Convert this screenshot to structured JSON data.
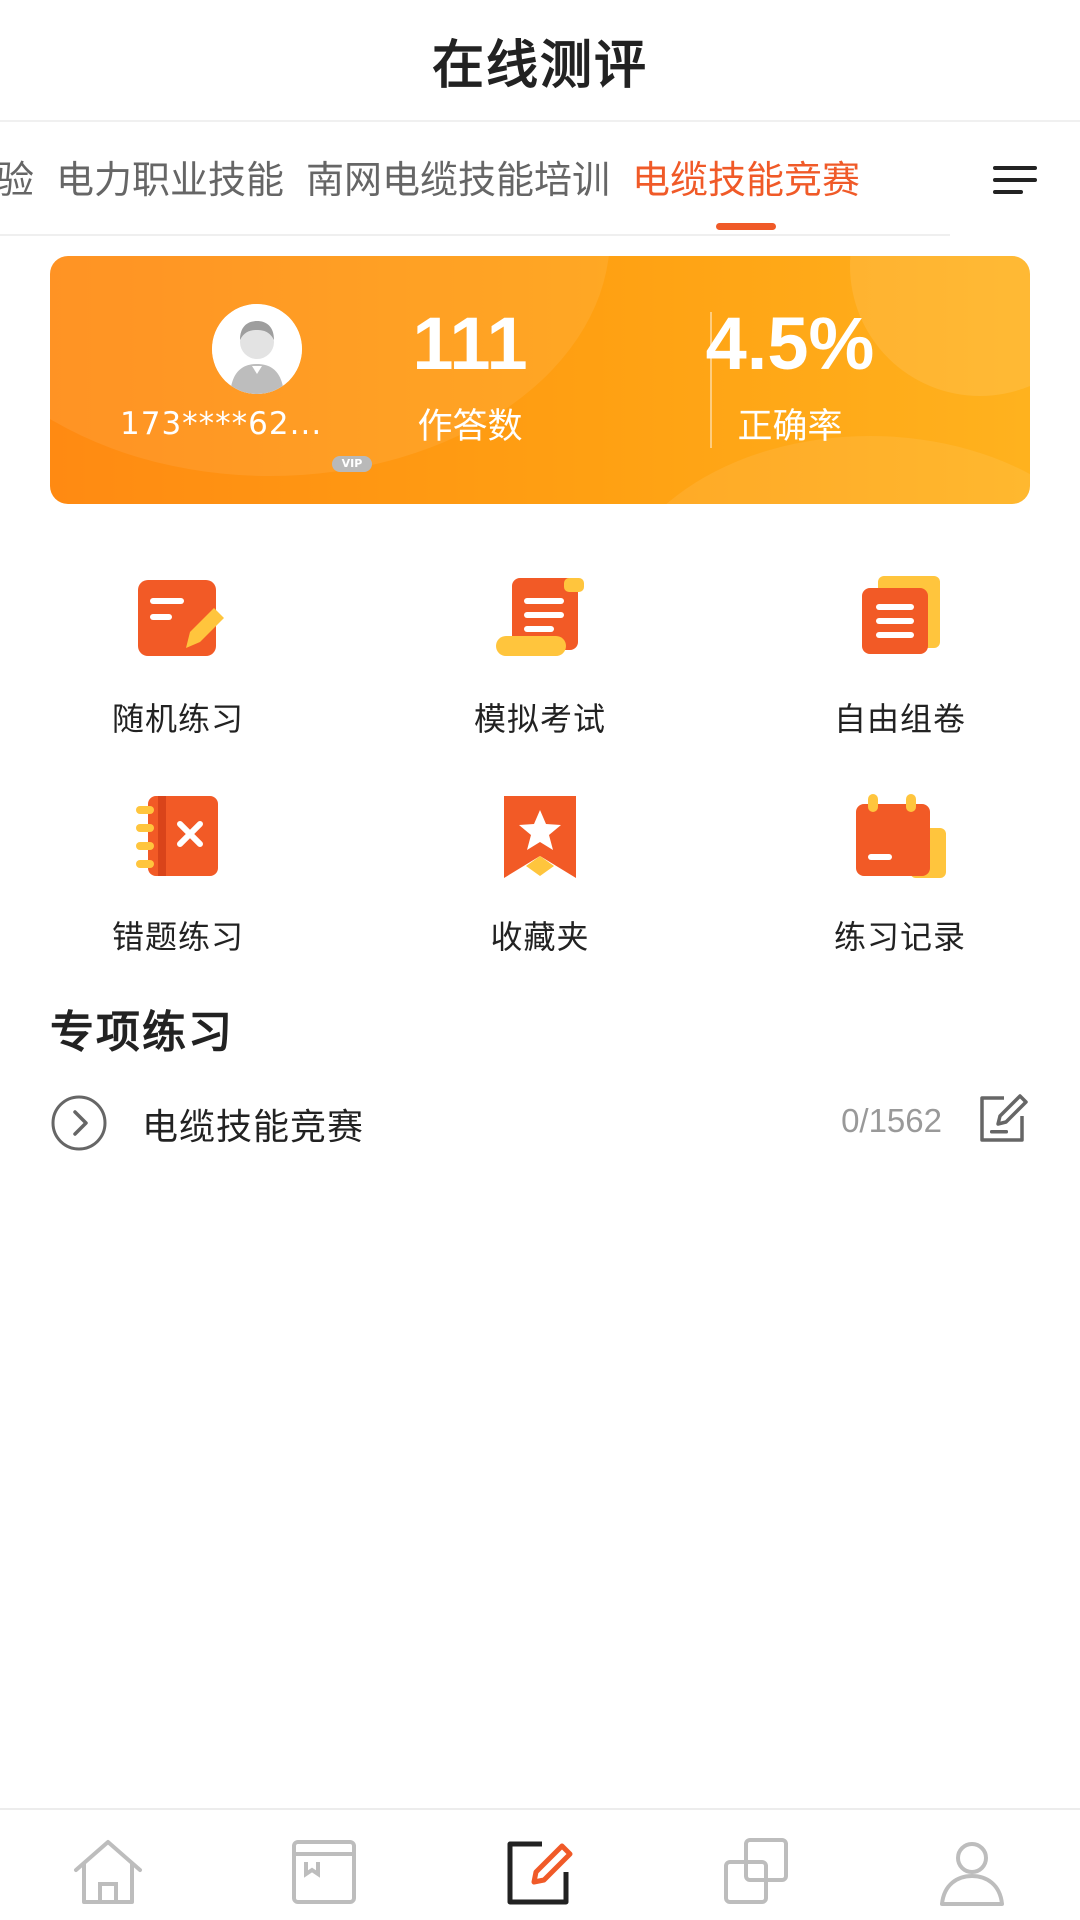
{
  "header": {
    "title": "在线测评"
  },
  "tabs": {
    "items": [
      {
        "label": "验"
      },
      {
        "label": "电力职业技能"
      },
      {
        "label": "南网电缆技能培训"
      },
      {
        "label": "电缆技能竞赛"
      }
    ],
    "active_index": 3,
    "menu_icon": "menu-icon"
  },
  "banner": {
    "user": {
      "phone": "173****62...",
      "badge": "VIP",
      "avatar_icon": "avatar-icon"
    },
    "stats": [
      {
        "value": "111",
        "label": "作答数"
      },
      {
        "value": "4.5%",
        "label": "正确率"
      }
    ]
  },
  "grid": {
    "items": [
      {
        "label": "随机练习",
        "icon": "random-practice-icon"
      },
      {
        "label": "模拟考试",
        "icon": "mock-exam-icon"
      },
      {
        "label": "自由组卷",
        "icon": "free-paper-icon"
      },
      {
        "label": "错题练习",
        "icon": "wrong-questions-icon"
      },
      {
        "label": "收藏夹",
        "icon": "favorites-icon"
      },
      {
        "label": "练习记录",
        "icon": "practice-record-icon"
      }
    ]
  },
  "section": {
    "title": "专项练习",
    "rows": [
      {
        "name": "电缆技能竞赛",
        "progress": "0/1562",
        "icon": "chevron-right-circle-icon",
        "action_icon": "edit-icon"
      }
    ]
  },
  "bottom_nav": {
    "items": [
      {
        "icon": "home-icon"
      },
      {
        "icon": "course-icon"
      },
      {
        "icon": "exam-icon"
      },
      {
        "icon": "library-icon"
      },
      {
        "icon": "profile-icon"
      }
    ],
    "active_index": 2
  },
  "colors": {
    "accent": "#f05a28",
    "banner_start": "#ff8a12",
    "banner_end": "#ffb21e",
    "icon_orange": "#f25a26",
    "icon_yellow": "#ffc53d"
  }
}
